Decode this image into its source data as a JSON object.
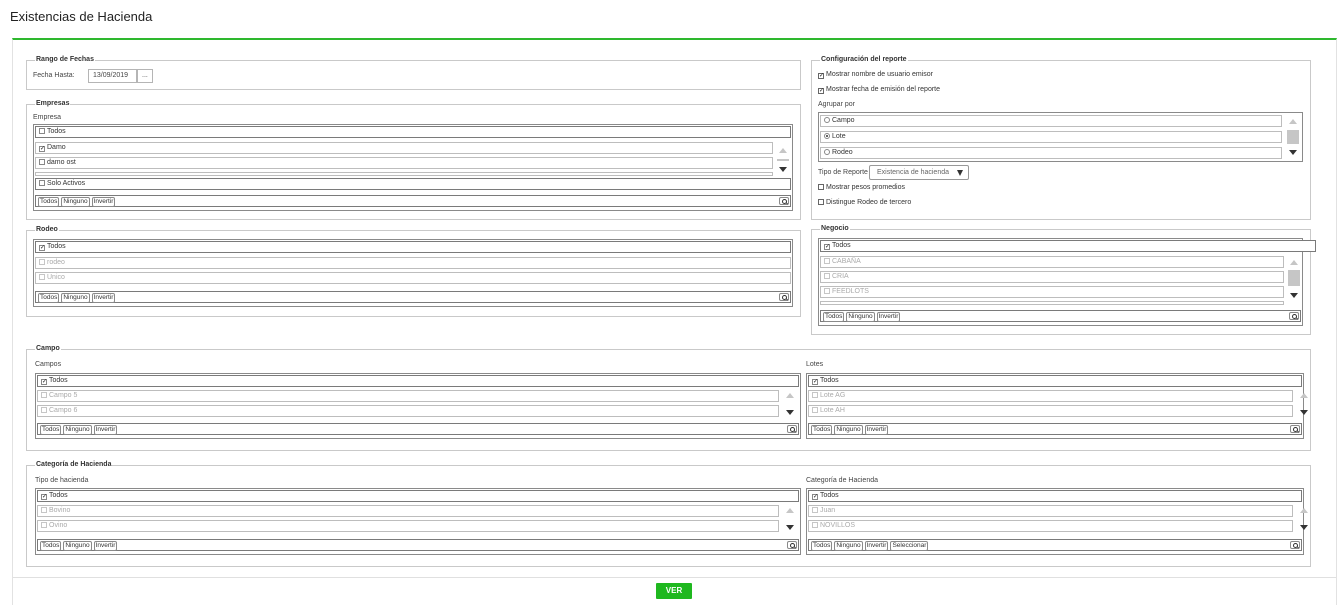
{
  "page": {
    "title": "Existencias de Hacienda"
  },
  "common": {
    "all": "Todos",
    "none": "Ninguno",
    "invert": "Invertir",
    "select": "Seleccionar"
  },
  "rango_fechas": {
    "legend": "Rango de Fechas",
    "fecha_label": "Fecha Hasta:",
    "fecha_value": "13/09/2019",
    "picker": "..."
  },
  "empresas": {
    "legend": "Empresas",
    "label": "Empresa",
    "head": "Todos",
    "items": [
      {
        "label": "Damo",
        "checked": true
      },
      {
        "label": "damo ost",
        "checked": false
      }
    ],
    "solo_activos": "Solo Activos"
  },
  "rodeo": {
    "legend": "Rodeo",
    "head": "Todos",
    "items": [
      {
        "label": "rodeo"
      },
      {
        "label": "Unico"
      }
    ]
  },
  "config": {
    "legend": "Configuración del reporte",
    "mostrar_usuario": "Mostrar nombre de usuario emisor",
    "mostrar_fecha": "Mostrar fecha de emisión del reporte",
    "agrupar_label": "Agrupar por",
    "agrupar_items": [
      {
        "label": "Campo"
      },
      {
        "label": "Lote"
      },
      {
        "label": "Rodeo"
      }
    ],
    "tipo_label": "Tipo de Reporte",
    "tipo_value": "Existencia de hacienda",
    "pesos": "Mostrar pesos promedios",
    "rodeo_tercero": "Distingue Rodeo de tercero"
  },
  "negocio": {
    "legend": "Negocio",
    "head": "Todos",
    "items": [
      {
        "label": "CABAÑA"
      },
      {
        "label": "CRIA"
      },
      {
        "label": "FEEDLOTS"
      }
    ]
  },
  "campo": {
    "legend": "Campo",
    "campos_label": "Campos",
    "campos_head": "Todos",
    "campos_items": [
      {
        "label": "Campo 5"
      },
      {
        "label": "Campo 6"
      }
    ],
    "lotes_label": "Lotes",
    "lotes_head": "Todos",
    "lotes_items": [
      {
        "label": "Lote AG"
      },
      {
        "label": "Lote AH"
      }
    ]
  },
  "categoria": {
    "legend": "Categoría de Hacienda",
    "tipo_label": "Tipo de hacienda",
    "tipo_head": "Todos",
    "tipo_items": [
      {
        "label": "Bovino"
      },
      {
        "label": "Ovino"
      }
    ],
    "cat_label": "Categoría de Hacienda",
    "cat_head": "Todos",
    "cat_items": [
      {
        "label": "Juan"
      },
      {
        "label": "NOVILLOS"
      }
    ]
  },
  "actions": {
    "ver": "VER"
  },
  "colors": {
    "accent": "#2eb82e",
    "button": "#1fb81f"
  }
}
